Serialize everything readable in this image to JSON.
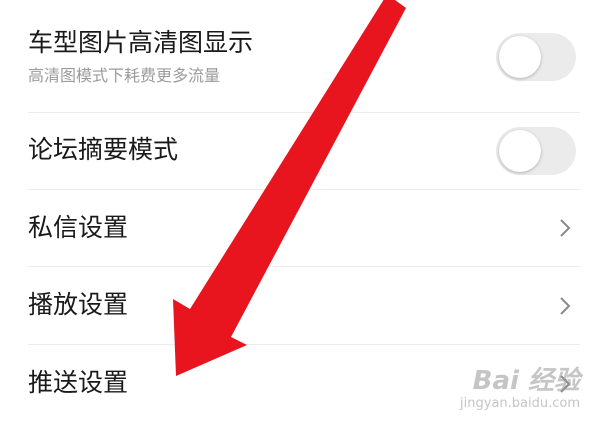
{
  "settings": {
    "items": [
      {
        "title": "车型图片高清图显示",
        "subtitle": "高清图模式下耗费更多流量",
        "control": "toggle",
        "on": false
      },
      {
        "title": "论坛摘要模式",
        "control": "toggle",
        "on": false
      },
      {
        "title": "私信设置",
        "control": "chevron"
      },
      {
        "title": "播放设置",
        "control": "chevron"
      },
      {
        "title": "推送设置",
        "control": "chevron"
      }
    ]
  },
  "annotation": {
    "arrow_color": "#e8141e"
  },
  "watermark": {
    "brand": "Bai 经验",
    "site": "jingyan.baidu.com"
  },
  "colors": {
    "toggle_off": "#ebebeb",
    "divider": "#ececec",
    "subtitle": "#9b9b9b"
  }
}
